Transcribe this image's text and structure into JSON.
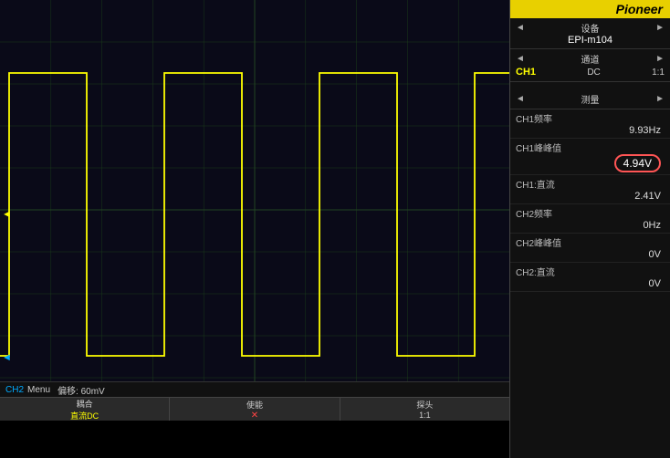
{
  "logo": {
    "brand": "Pioneer"
  },
  "right_panel": {
    "device_label": "设备",
    "device_name": "EPI-m104",
    "channel_label": "通道",
    "ch1_label": "CH1",
    "ch1_coupling": "DC",
    "ch1_ratio": "1:1",
    "measure_label": "测量",
    "ch1_freq_label": "CH1频率",
    "ch1_freq_value": "9.93Hz",
    "ch1_peakpeak_label": "CH1峰峰值",
    "ch1_peakpeak_value": "4.94V",
    "ch1_dc_label": "CH1:直流",
    "ch1_dc_value": "2.41V",
    "ch2_freq_label": "CH2频率",
    "ch2_freq_value": "0Hz",
    "ch2_peakpeak_label": "CH2峰峰值",
    "ch2_peakpeak_value": "0V",
    "ch2_dc_label": "CH2:直流",
    "ch2_dc_value": "0V"
  },
  "bottom_bar": {
    "ch2_label": "CH2",
    "menu_label": "Menu",
    "timebase_label": "偏移: 60mV",
    "btn1_top": "耦合",
    "btn1_bot": "直流DC",
    "btn2_top": "使能",
    "btn2_icon": "✕",
    "btn3_top": "探头",
    "btn3_bot": "1:1"
  },
  "waveform": {
    "color": "#ffff00",
    "grid_color": "#1a3a1a"
  }
}
